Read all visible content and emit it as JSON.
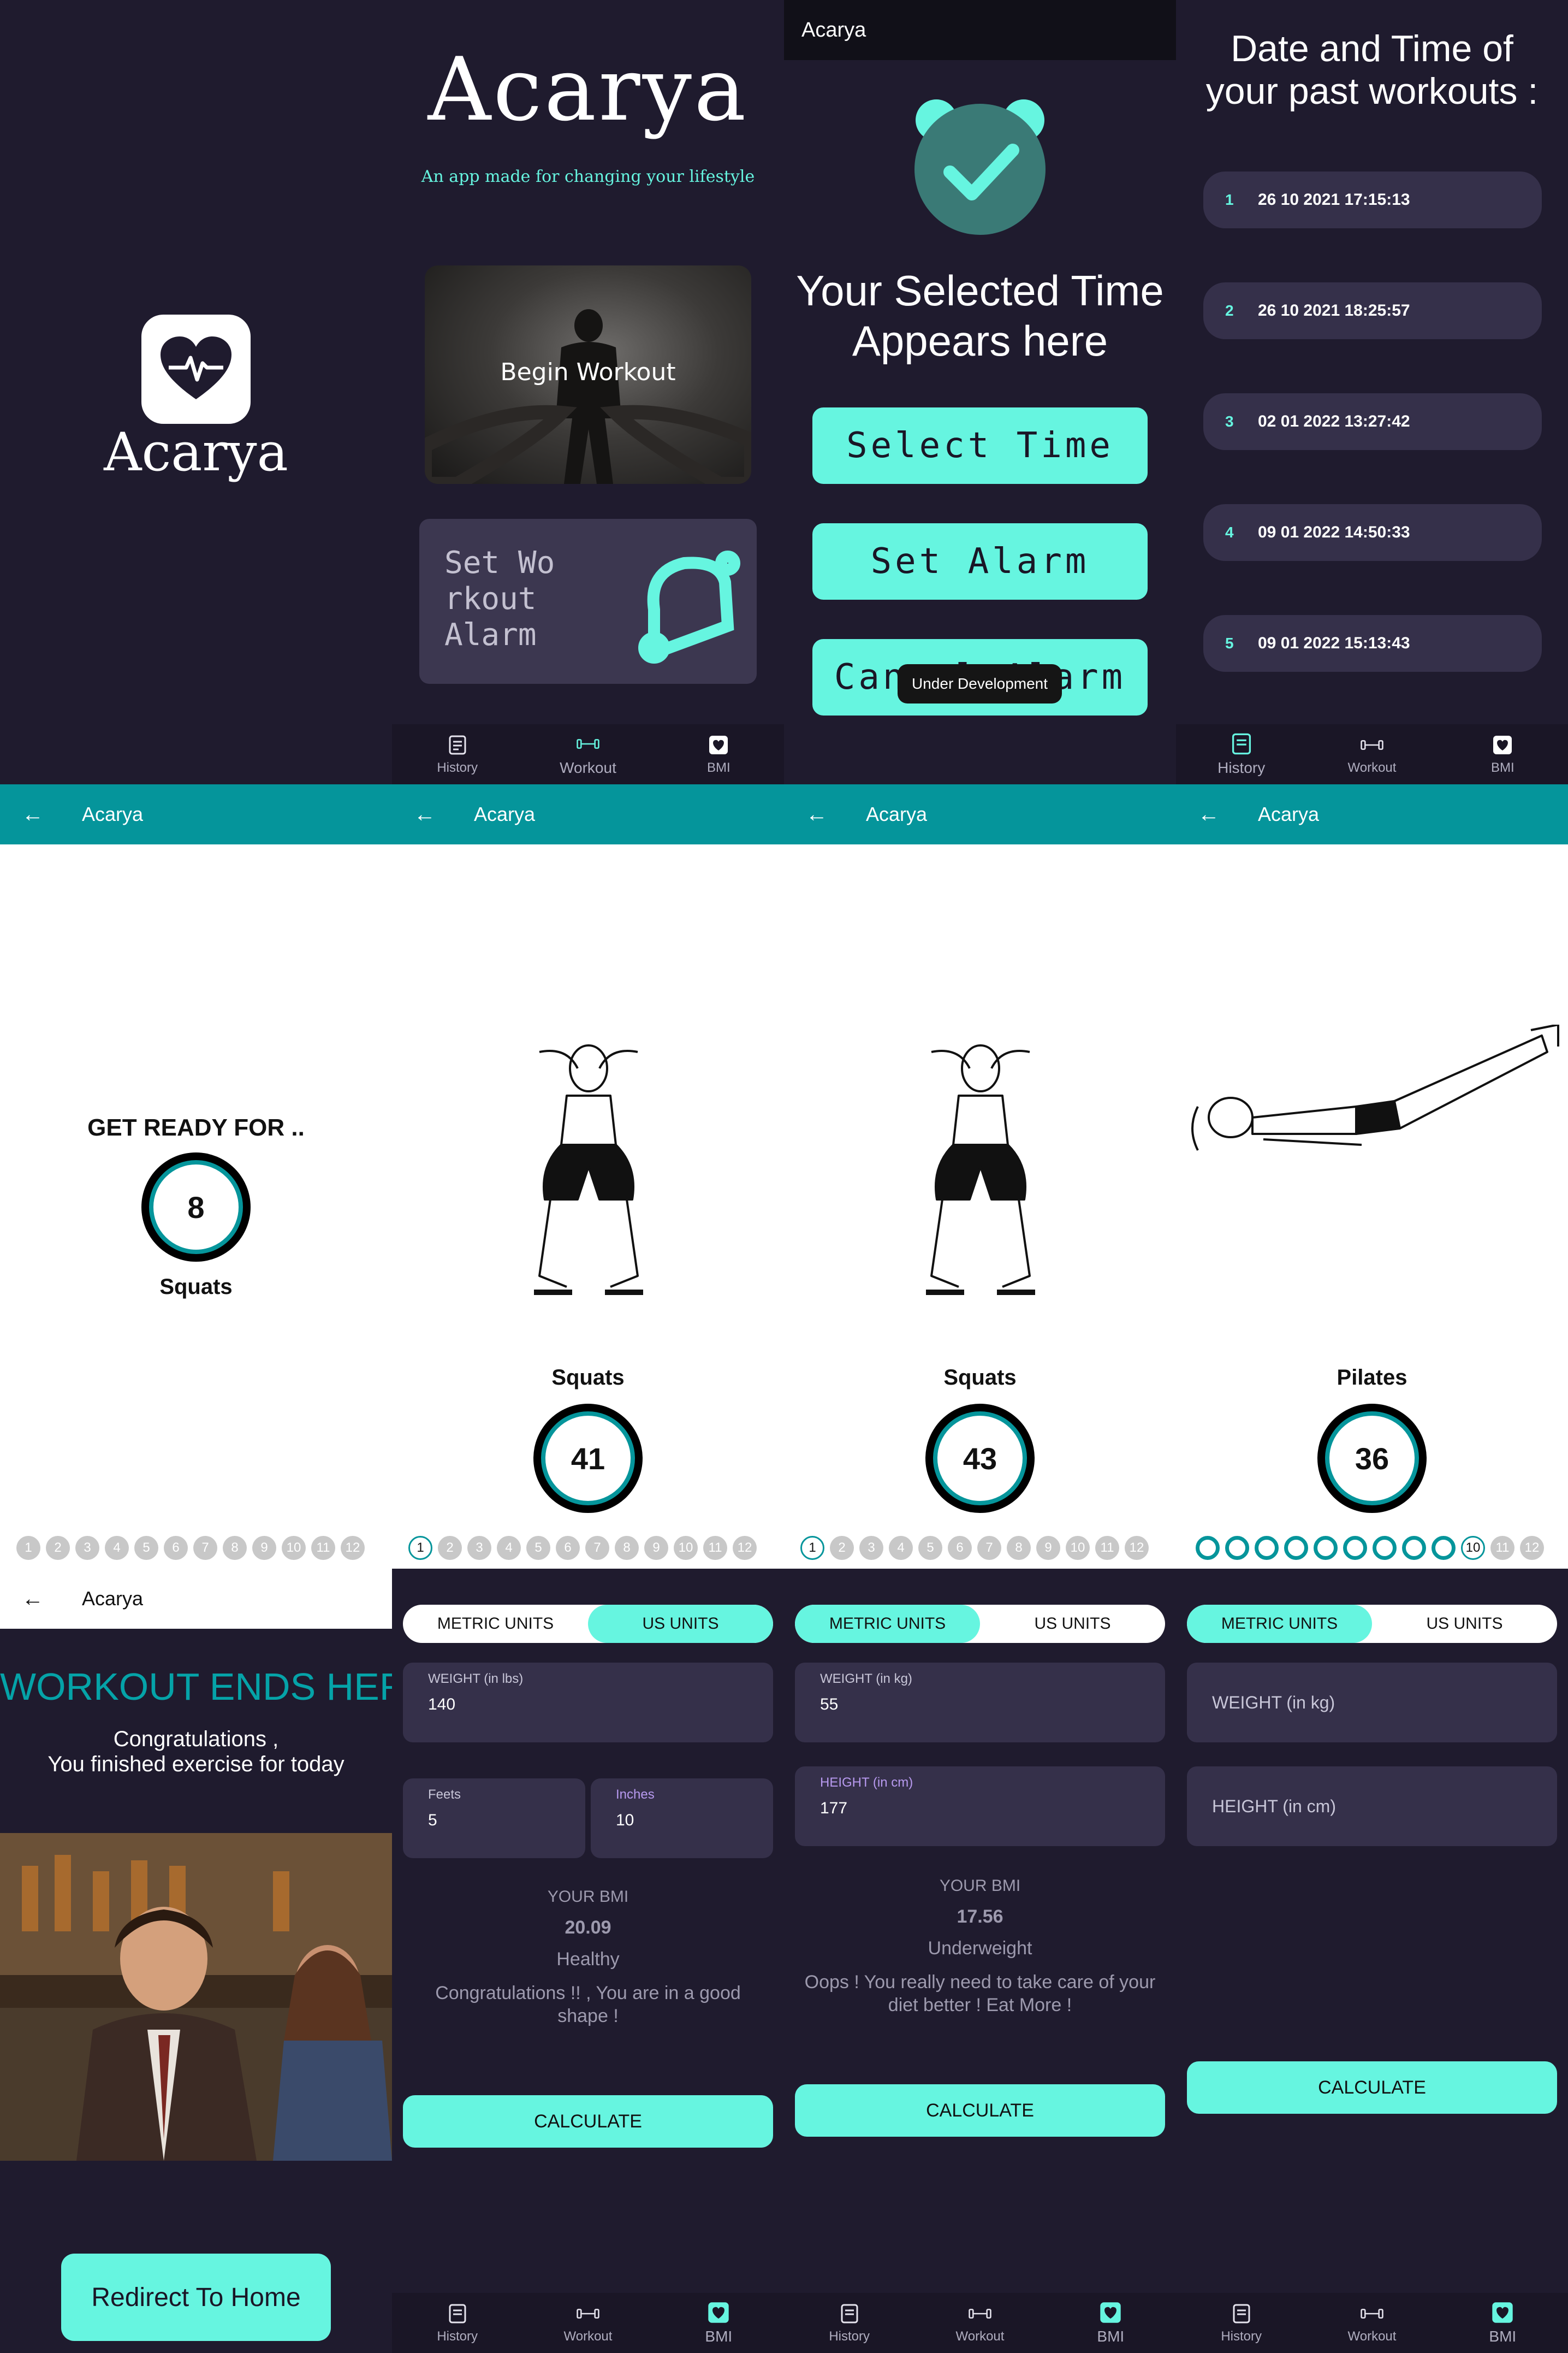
{
  "splash": {
    "app_name": "Acarya"
  },
  "home": {
    "title": "Acarya",
    "tagline": "An app made for changing your lifestyle",
    "begin_workout": "Begin Workout",
    "alarm_card": "Set Wo\nrkout\nAlarm",
    "nav": [
      "History",
      "Workout",
      "BMI"
    ]
  },
  "alarm": {
    "app_title": "Acarya",
    "selected_time": "Your Selected Time Appears here",
    "select_time": "Select Time",
    "set_alarm": "Set Alarm",
    "cancel_alarm": "Cancel Alarm",
    "toast": "Under Development"
  },
  "history": {
    "heading": "Date and Time of your past workouts :",
    "rows": [
      {
        "n": "1",
        "date": "26 10 2021 17:15:13"
      },
      {
        "n": "2",
        "date": "26 10 2021 18:25:57"
      },
      {
        "n": "3",
        "date": "02 01 2022 13:27:42"
      },
      {
        "n": "4",
        "date": "09 01 2022 14:50:33"
      },
      {
        "n": "5",
        "date": "09 01 2022 15:13:43"
      }
    ],
    "nav": [
      "History",
      "Workout",
      "BMI"
    ]
  },
  "exercise": {
    "app_title": "Acarya",
    "get_ready": "GET READY FOR ..",
    "ready_timer": "8",
    "ready_name": "Squats",
    "screen2": {
      "name": "Squats",
      "timer": "41"
    },
    "screen3": {
      "name": "Squats",
      "timer": "43"
    },
    "screen4": {
      "name": "Pilates",
      "timer": "36"
    },
    "steps": [
      "1",
      "2",
      "3",
      "4",
      "5",
      "6",
      "7",
      "8",
      "9",
      "10",
      "11",
      "12"
    ]
  },
  "finish": {
    "app_title": "Acarya",
    "heading": "WORKOUT ENDS HERE",
    "line1": "Congratulations ,",
    "line2": "You finished exercise for today",
    "redirect": "Redirect To Home"
  },
  "bmi": {
    "metric": "METRIC UNITS",
    "us": "US UNITS",
    "us_screen": {
      "weight_label": "WEIGHT (in lbs)",
      "weight": "140",
      "feet_label": "Feets",
      "feet": "5",
      "inches_label": "Inches",
      "inches": "10",
      "your_bmi": "YOUR BMI",
      "value": "20.09",
      "status": "Healthy",
      "message": "Congratulations !! , You are in a good shape !",
      "calculate": "CALCULATE"
    },
    "metric_screen": {
      "weight_label": "WEIGHT (in kg)",
      "weight": "55",
      "height_label": "HEIGHT (in cm)",
      "height": "177",
      "your_bmi": "YOUR BMI",
      "value": "17.56",
      "status": "Underweight",
      "message": "Oops ! You really need to take care of your diet better ! Eat More !",
      "calculate": "CALCULATE"
    },
    "empty_screen": {
      "weight_placeholder": "WEIGHT (in kg)",
      "height_placeholder": "HEIGHT (in cm)",
      "calculate": "CALCULATE"
    },
    "nav": [
      "History",
      "Workout",
      "BMI"
    ]
  },
  "colors": {
    "accent": "#66f5e0",
    "teal": "#05959b",
    "background": "#1f1b2e",
    "card": "#35304a"
  }
}
